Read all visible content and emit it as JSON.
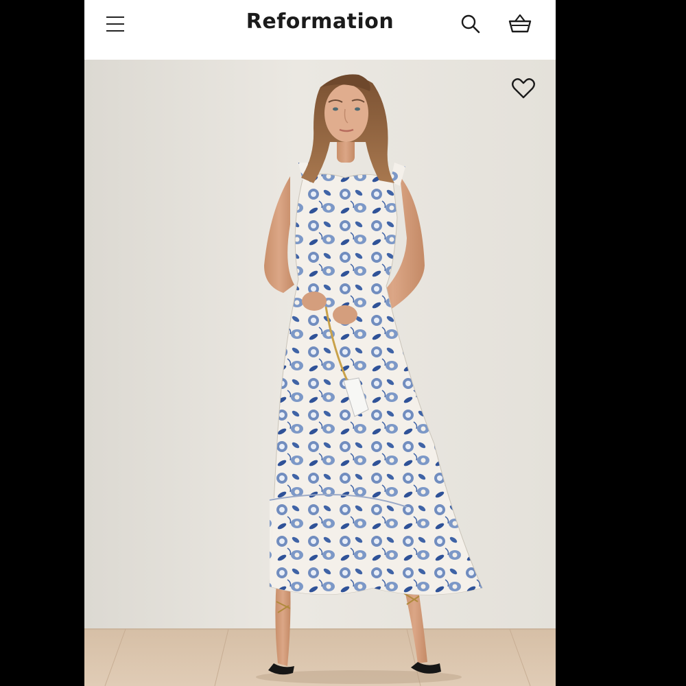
{
  "header": {
    "brand": "Reformation",
    "menu_icon": "hamburger-menu-icon",
    "search_icon": "search-icon",
    "cart_icon": "basket-icon"
  },
  "product": {
    "image": "model-in-blue-floral-dress",
    "favorite_icon": "heart-icon"
  },
  "colors": {
    "header_bg": "#ffffff",
    "backdrop": "#e8e5df",
    "floor": "#d8c2aa",
    "dress_base": "#f3efe8",
    "dress_print": "#4d6fae",
    "text": "#1b1b1b"
  }
}
